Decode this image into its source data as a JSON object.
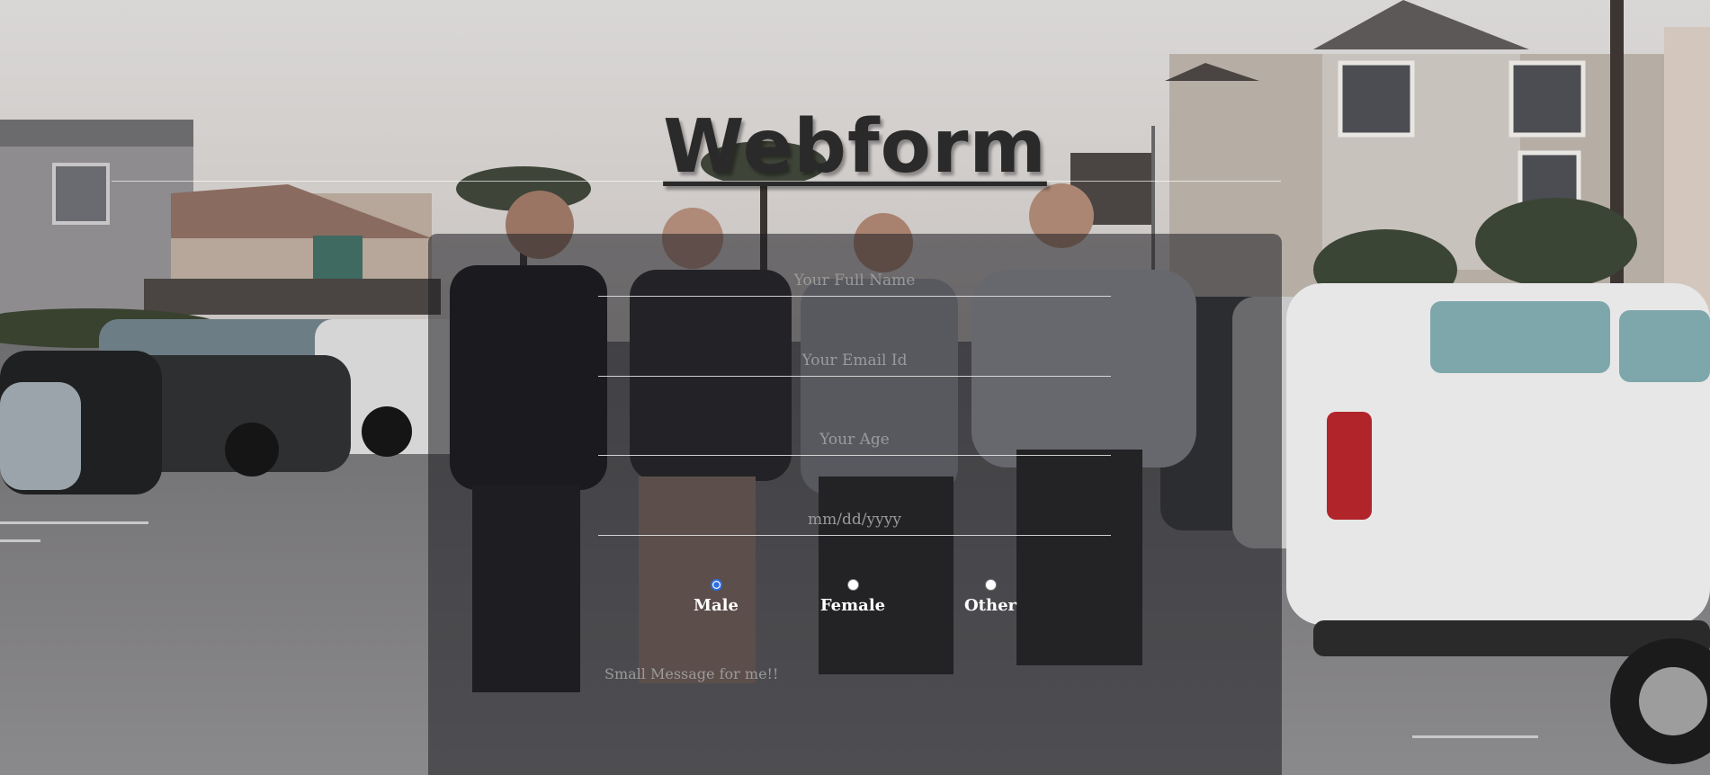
{
  "page": {
    "title": "Webform"
  },
  "form": {
    "full_name": {
      "placeholder": "Your Full Name",
      "value": ""
    },
    "email": {
      "placeholder": "Your Email Id",
      "value": ""
    },
    "age": {
      "placeholder": "Your Age",
      "value": ""
    },
    "date": {
      "placeholder": "mm/dd/yyyy",
      "value": ""
    },
    "gender": {
      "options": [
        "Male",
        "Female",
        "Other"
      ],
      "selected": "Male"
    },
    "message": {
      "placeholder": "Small Message for me!!",
      "value": ""
    }
  },
  "colors": {
    "title": "#2a2a2a",
    "panel": "#1e1e22",
    "radio_checked": "#2f6fdc",
    "label": "#ffffff",
    "placeholder": "#9a9a9a"
  }
}
